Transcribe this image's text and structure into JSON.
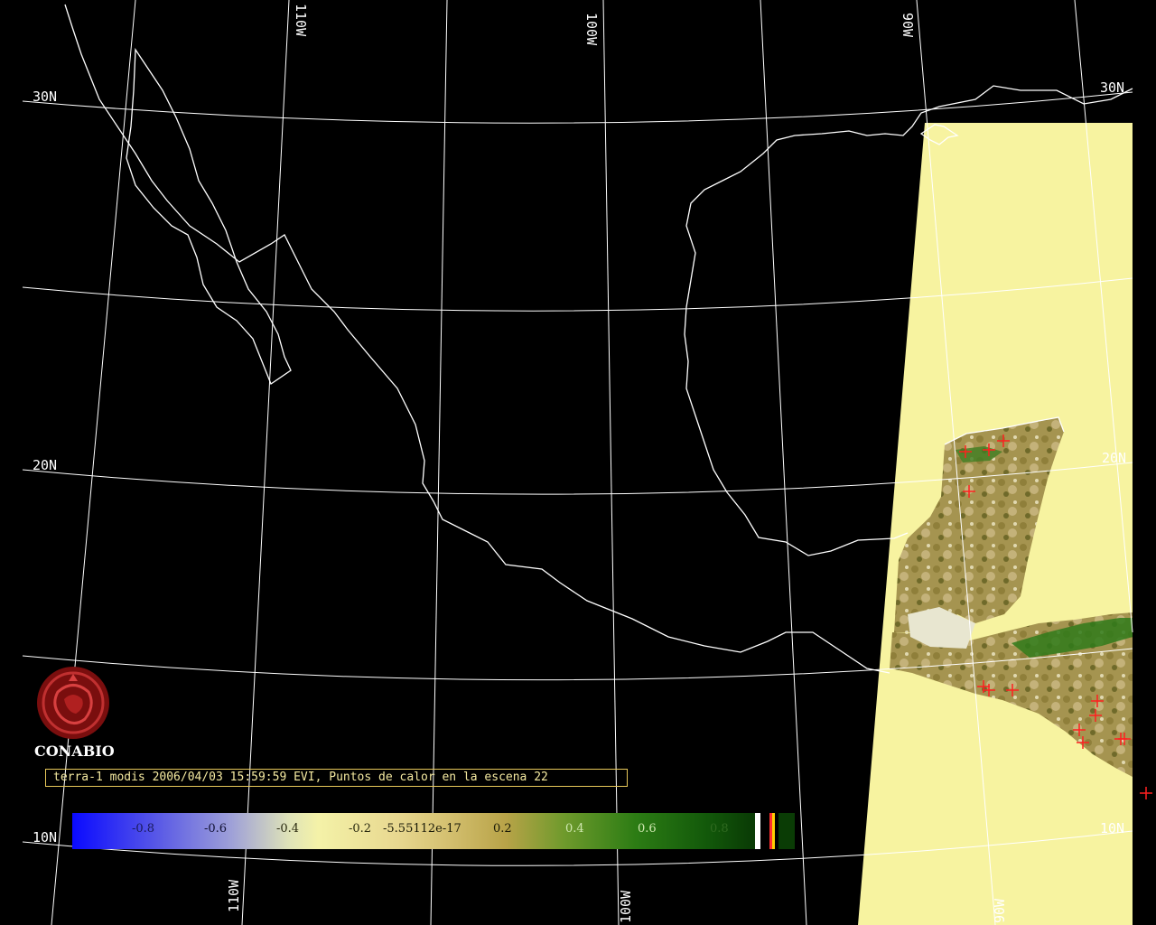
{
  "map": {
    "latitude_labels": [
      "30N",
      "20N",
      "10N"
    ],
    "longitude_labels": [
      "110W",
      "100W",
      "90W"
    ],
    "colors": {
      "background": "#000000",
      "gridlines": "#ffffff",
      "coastline": "#ffffff",
      "swath_fill": "#f7f3a0",
      "vegetation_high": "#1f6e14",
      "vegetation_mid": "#a08c3c",
      "hotspot_marker": "#ff2020",
      "caption_border": "#e8c85a"
    }
  },
  "logo": {
    "name": "CONABIO",
    "icon": "conabio-seal-icon"
  },
  "caption": {
    "text": "terra-1 modis 2006/04/03 15:59:59 EVI, Puntos de calor en la escena 22"
  },
  "colorbar": {
    "ticks": [
      "-0.8",
      "-0.6",
      "-0.4",
      "-0.2",
      "-5.55112e-17",
      "0.2",
      "0.4",
      "0.6",
      "0.8"
    ],
    "tick_values": [
      -0.8,
      -0.6,
      -0.4,
      -0.2,
      0,
      0.2,
      0.4,
      0.6,
      0.8
    ],
    "tick_colors": [
      "#1a1a5a",
      "#111133",
      "#2a2a10",
      "#2a2a10",
      "#1a1a08",
      "#1a1a08",
      "#cfe8b0",
      "#cfe8b0",
      "#2f6a20"
    ],
    "end_stripe_colors": [
      "#ffffff",
      "#000000",
      "#ff3030",
      "#ffd000",
      "#000000"
    ]
  }
}
